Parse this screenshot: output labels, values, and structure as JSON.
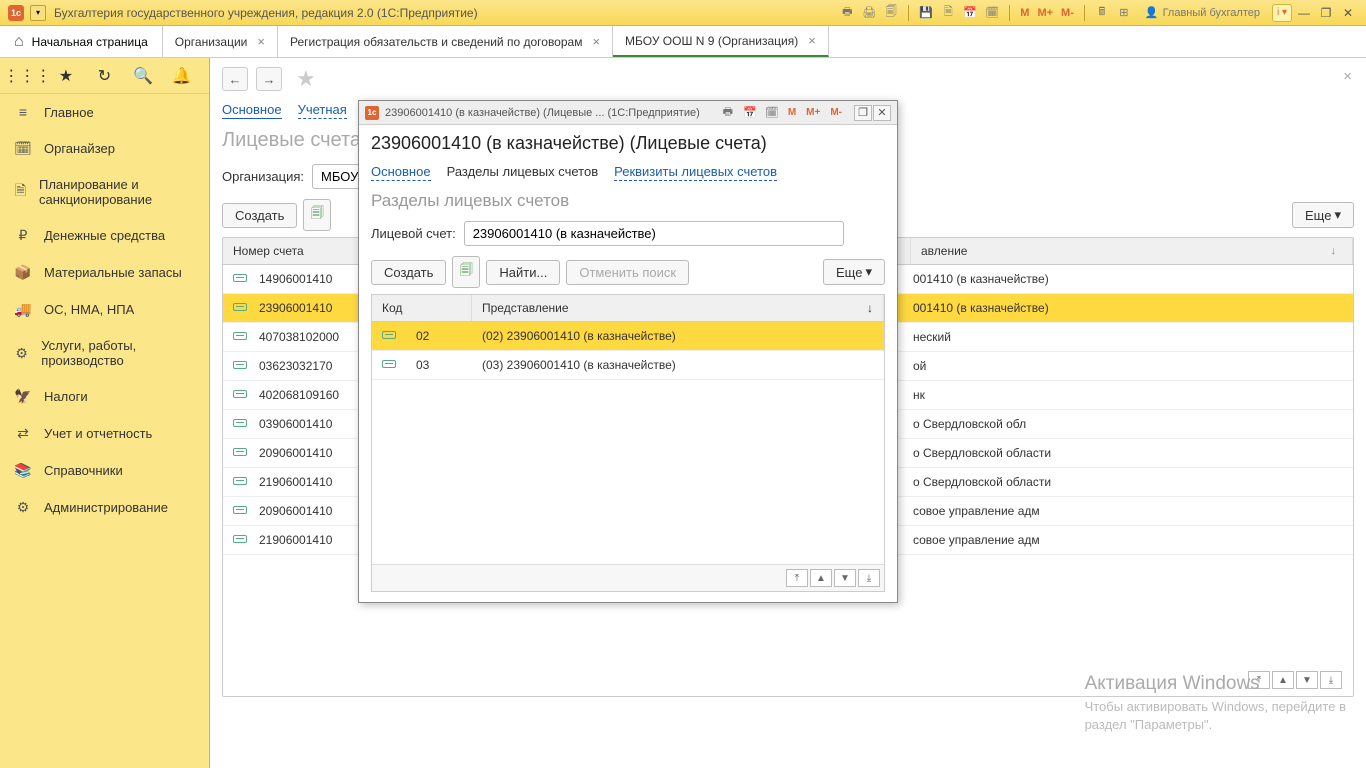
{
  "titlebar": {
    "app_title": "Бухгалтерия государственного учреждения, редакция 2.0  (1С:Предприятие)",
    "user_label": "Главный бухгалтер",
    "m_buttons": [
      "M",
      "M+",
      "M-"
    ]
  },
  "tabs": {
    "home": "Начальная страница",
    "items": [
      {
        "label": "Организации"
      },
      {
        "label": "Регистрация обязательств и сведений по договорам"
      },
      {
        "label": "МБОУ ООШ N 9 (Организация)"
      }
    ],
    "active_index": 2
  },
  "sidebar": {
    "items": [
      {
        "icon": "≡",
        "label": "Главное"
      },
      {
        "icon": "🗓",
        "label": "Органайзер"
      },
      {
        "icon": "🗎",
        "label": "Планирование и санкционирование"
      },
      {
        "icon": "₽",
        "label": "Денежные средства"
      },
      {
        "icon": "📦",
        "label": "Материальные запасы"
      },
      {
        "icon": "🚚",
        "label": "ОС, НМА, НПА"
      },
      {
        "icon": "⚙",
        "label": "Услуги, работы, производство"
      },
      {
        "icon": "🦅",
        "label": "Налоги"
      },
      {
        "icon": "⇄",
        "label": "Учет и отчетность"
      },
      {
        "icon": "📚",
        "label": "Справочники"
      },
      {
        "icon": "⚙",
        "label": "Администрирование"
      }
    ]
  },
  "background_page": {
    "subtabs": [
      "Основное",
      "Учетная"
    ],
    "title": "Лицевые счета",
    "org_label": "Организация:",
    "org_value": "МБОУ",
    "create_btn": "Создать",
    "more_btn": "Еще",
    "columns": {
      "number": "Номер счета",
      "repr": "авление"
    },
    "rows": [
      {
        "num": "14906001410",
        "repr": "001410 (в казначействе)"
      },
      {
        "num": "23906001410",
        "repr": "001410 (в казначействе)"
      },
      {
        "num": "407038102000",
        "repr": "неский"
      },
      {
        "num": "03623032170",
        "repr": "ой"
      },
      {
        "num": "402068109160",
        "repr": "нк"
      },
      {
        "num": "03906001410",
        "repr": "о Свердловской обл"
      },
      {
        "num": "20906001410",
        "repr": "о Свердловской области"
      },
      {
        "num": "21906001410",
        "repr": "о Свердловской области"
      },
      {
        "num": "20906001410",
        "repr": "совое управление адм"
      },
      {
        "num": "21906001410",
        "repr": "совое управление адм"
      }
    ],
    "selected_index": 1
  },
  "dialog": {
    "title": "23906001410 (в казначействе) (Лицевые ...   (1С:Предприятие)",
    "heading": "23906001410 (в казначействе) (Лицевые счета)",
    "subtabs": [
      "Основное",
      "Разделы лицевых счетов",
      "Реквизиты лицевых счетов"
    ],
    "active_subtab": 1,
    "section_title": "Разделы лицевых счетов",
    "account_label": "Лицевой счет:",
    "account_value": "23906001410 (в казначействе)",
    "create_btn": "Создать",
    "find_btn": "Найти...",
    "cancel_find_btn": "Отменить поиск",
    "more_btn": "Еще",
    "columns": {
      "code": "Код",
      "repr": "Представление"
    },
    "rows": [
      {
        "code": "02",
        "repr": "(02) 23906001410 (в казначействе)"
      },
      {
        "code": "03",
        "repr": "(03) 23906001410 (в казначействе)"
      }
    ],
    "selected_index": 0,
    "m_buttons": [
      "M",
      "M+",
      "M-"
    ]
  },
  "watermark": {
    "title": "Активация Windows",
    "line1": "Чтобы активировать Windows, перейдите в",
    "line2": "раздел \"Параметры\"."
  }
}
